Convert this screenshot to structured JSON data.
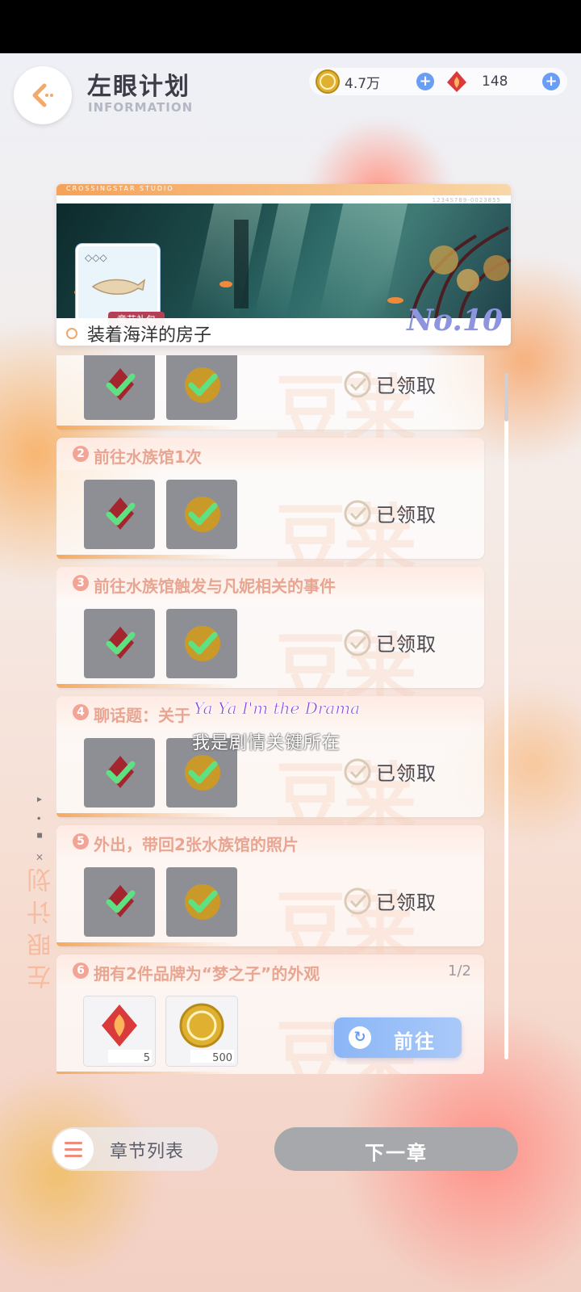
{
  "header": {
    "title": "左眼计划",
    "subtitle": "INFORMATION",
    "back_icon": "back-arrow-icon"
  },
  "currencies": [
    {
      "name": "gold-coin",
      "value": "4.7万",
      "color": "#e0b130"
    },
    {
      "name": "red-crystal",
      "value": "148",
      "color": "#d93a3a"
    }
  ],
  "banner": {
    "studio": "CROSSINGSTAR STUDIO",
    "code": "1234S789-0023855",
    "gift_label": "章节礼包",
    "name": "装着海洋的房子",
    "number": "No.10"
  },
  "tasks": [
    {
      "num": "",
      "title": "",
      "status": "已领取",
      "rewards": [
        "crystal",
        "coin"
      ],
      "claimed": true
    },
    {
      "num": "2",
      "title": "前往水族馆1次",
      "status": "已领取",
      "rewards": [
        "crystal",
        "coin"
      ],
      "claimed": true
    },
    {
      "num": "3",
      "title": "前往水族馆触发与凡妮相关的事件",
      "status": "已领取",
      "rewards": [
        "crystal",
        "coin"
      ],
      "claimed": true
    },
    {
      "num": "4",
      "title": "聊话题：关于",
      "status": "已领取",
      "rewards": [
        "crystal",
        "coin"
      ],
      "claimed": true
    },
    {
      "num": "5",
      "title": "外出，带回2张水族馆的照片",
      "status": "已领取",
      "rewards": [
        "crystal",
        "coin"
      ],
      "claimed": true
    },
    {
      "num": "6",
      "title": "拥有2件品牌为“梦之子”的外观",
      "progress": "1/2",
      "reward_qty": [
        "5",
        "500"
      ],
      "action": "前往",
      "claimed": false
    }
  ],
  "side": {
    "text": "左眼计划",
    "marks": "× ▪ • ◂"
  },
  "overlay": {
    "en": "Ya Ya I'm the Drama",
    "cn": "我是剧情关键所在"
  },
  "bottom": {
    "chapter_list": "章节列表",
    "next": "下一章"
  },
  "watermark": "豆莱"
}
